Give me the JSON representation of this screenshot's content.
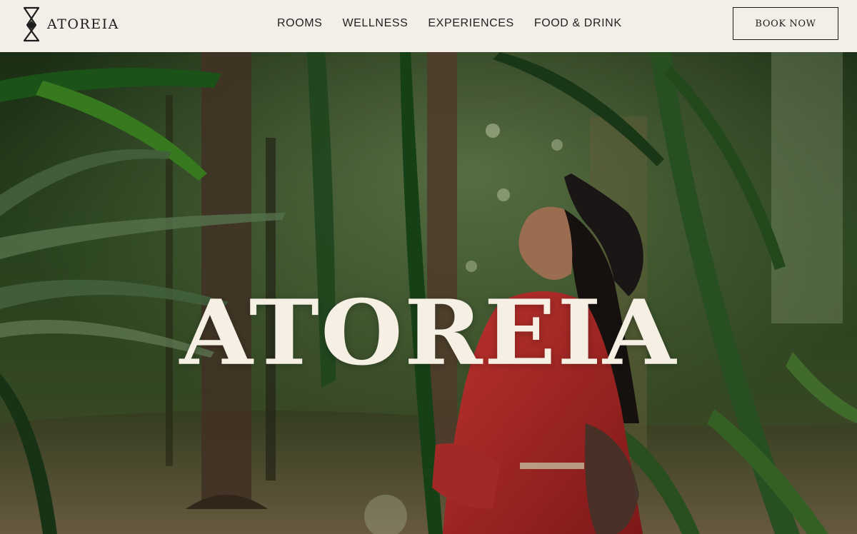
{
  "header": {
    "logo_text": "ATOREIA",
    "nav": [
      {
        "label": "ROOMS"
      },
      {
        "label": "WELLNESS"
      },
      {
        "label": "EXPERIENCES"
      },
      {
        "label": "FOOD & DRINK"
      }
    ],
    "book_label": "BOOK NOW"
  },
  "hero": {
    "title": "ATOREIA"
  },
  "colors": {
    "header_bg": "#f3eee8",
    "title": "#f5efe4",
    "dress_red": "#c62a2a",
    "foliage": "#2d4a22"
  },
  "icons": {
    "logo_mark": "atoreia-logo-icon"
  }
}
